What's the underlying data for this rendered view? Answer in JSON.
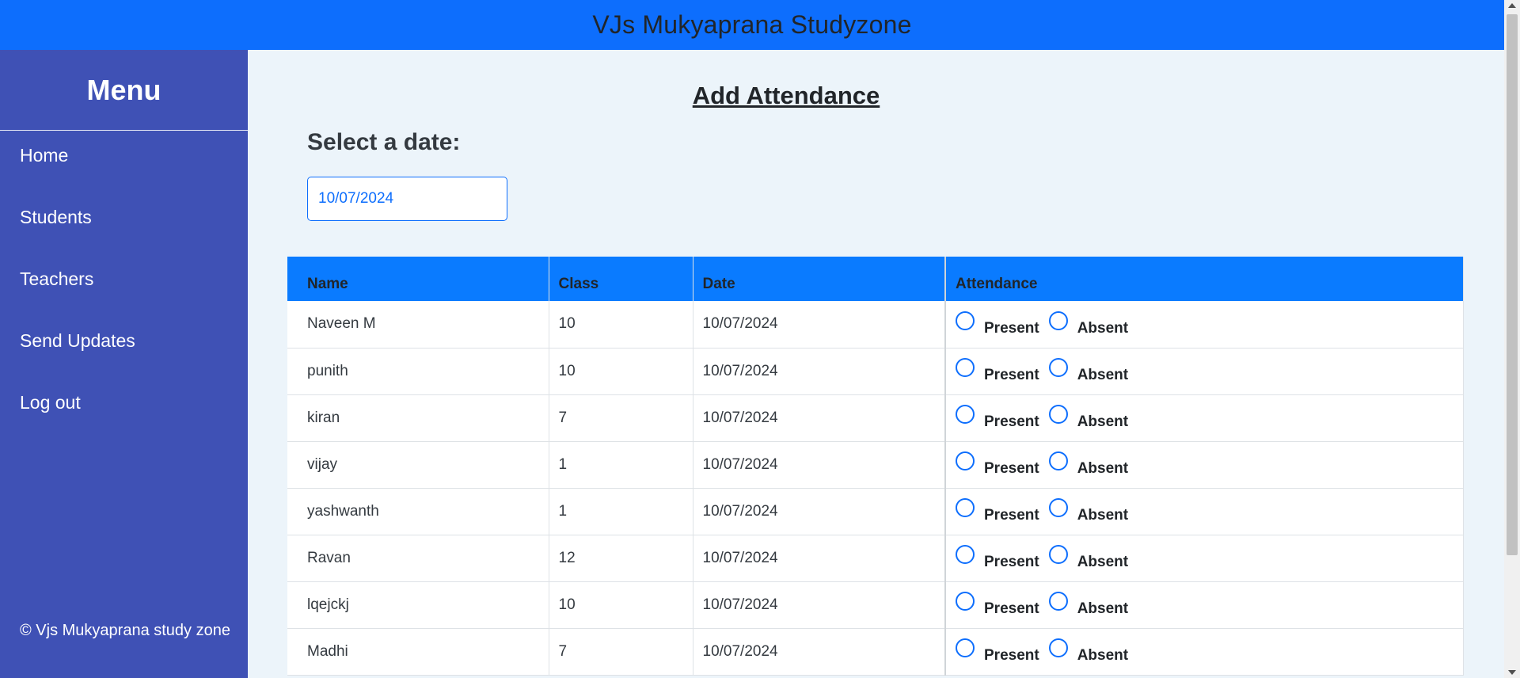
{
  "header": {
    "title": "VJs Mukyaprana Studyzone"
  },
  "sidebar": {
    "title": "Menu",
    "items": [
      {
        "label": "Home"
      },
      {
        "label": "Students"
      },
      {
        "label": "Teachers"
      },
      {
        "label": "Send Updates"
      },
      {
        "label": "Log out"
      }
    ],
    "footer": "© Vjs Mukyaprana study zone"
  },
  "main": {
    "title": "Add Attendance",
    "date_label": "Select a date:",
    "date_value": "10/07/2024",
    "table": {
      "headers": [
        "Name",
        "Class",
        "Date",
        "Attendance"
      ],
      "option_present": "Present",
      "option_absent": "Absent",
      "rows": [
        {
          "name": "Naveen M",
          "class": "10",
          "date": "10/07/2024"
        },
        {
          "name": "punith",
          "class": "10",
          "date": "10/07/2024"
        },
        {
          "name": "kiran",
          "class": "7",
          "date": "10/07/2024"
        },
        {
          "name": "vijay",
          "class": "1",
          "date": "10/07/2024"
        },
        {
          "name": "yashwanth",
          "class": "1",
          "date": "10/07/2024"
        },
        {
          "name": "Ravan",
          "class": "12",
          "date": "10/07/2024"
        },
        {
          "name": "lqejckj",
          "class": "10",
          "date": "10/07/2024"
        },
        {
          "name": "Madhi",
          "class": "7",
          "date": "10/07/2024"
        }
      ]
    }
  },
  "colors": {
    "header_bg": "#0d6efd",
    "sidebar_bg": "#3f51b5",
    "table_header_bg": "#0a7bff",
    "page_bg": "#ecf4fa"
  }
}
